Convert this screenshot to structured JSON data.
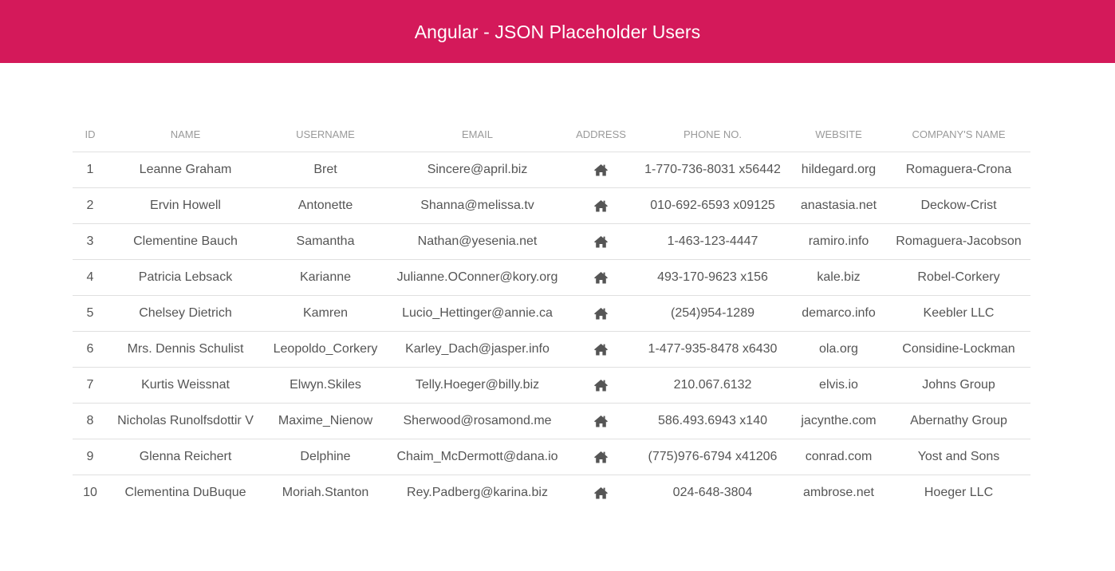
{
  "header": {
    "title": "Angular - JSON Placeholder Users",
    "background": "#d4195a"
  },
  "table": {
    "columns": [
      "ID",
      "NAME",
      "USERNAME",
      "EMAIL",
      "ADDRESS",
      "PHONE NO.",
      "WEBSITE",
      "COMPANY'S NAME"
    ],
    "address_icon": "home-icon",
    "rows": [
      {
        "id": "1",
        "name": "Leanne Graham",
        "username": "Bret",
        "email": "Sincere@april.biz",
        "phone": "1-770-736-8031 x56442",
        "website": "hildegard.org",
        "company": "Romaguera-Crona"
      },
      {
        "id": "2",
        "name": "Ervin Howell",
        "username": "Antonette",
        "email": "Shanna@melissa.tv",
        "phone": "010-692-6593 x09125",
        "website": "anastasia.net",
        "company": "Deckow-Crist"
      },
      {
        "id": "3",
        "name": "Clementine Bauch",
        "username": "Samantha",
        "email": "Nathan@yesenia.net",
        "phone": "1-463-123-4447",
        "website": "ramiro.info",
        "company": "Romaguera-Jacobson"
      },
      {
        "id": "4",
        "name": "Patricia Lebsack",
        "username": "Karianne",
        "email": "Julianne.OConner@kory.org",
        "phone": "493-170-9623 x156",
        "website": "kale.biz",
        "company": "Robel-Corkery"
      },
      {
        "id": "5",
        "name": "Chelsey Dietrich",
        "username": "Kamren",
        "email": "Lucio_Hettinger@annie.ca",
        "phone": "(254)954-1289",
        "website": "demarco.info",
        "company": "Keebler LLC"
      },
      {
        "id": "6",
        "name": "Mrs. Dennis Schulist",
        "username": "Leopoldo_Corkery",
        "email": "Karley_Dach@jasper.info",
        "phone": "1-477-935-8478 x6430",
        "website": "ola.org",
        "company": "Considine-Lockman"
      },
      {
        "id": "7",
        "name": "Kurtis Weissnat",
        "username": "Elwyn.Skiles",
        "email": "Telly.Hoeger@billy.biz",
        "phone": "210.067.6132",
        "website": "elvis.io",
        "company": "Johns Group"
      },
      {
        "id": "8",
        "name": "Nicholas Runolfsdottir V",
        "username": "Maxime_Nienow",
        "email": "Sherwood@rosamond.me",
        "phone": "586.493.6943 x140",
        "website": "jacynthe.com",
        "company": "Abernathy Group"
      },
      {
        "id": "9",
        "name": "Glenna Reichert",
        "username": "Delphine",
        "email": "Chaim_McDermott@dana.io",
        "phone": "(775)976-6794 x41206",
        "website": "conrad.com",
        "company": "Yost and Sons"
      },
      {
        "id": "10",
        "name": "Clementina DuBuque",
        "username": "Moriah.Stanton",
        "email": "Rey.Padberg@karina.biz",
        "phone": "024-648-3804",
        "website": "ambrose.net",
        "company": "Hoeger LLC"
      }
    ]
  }
}
